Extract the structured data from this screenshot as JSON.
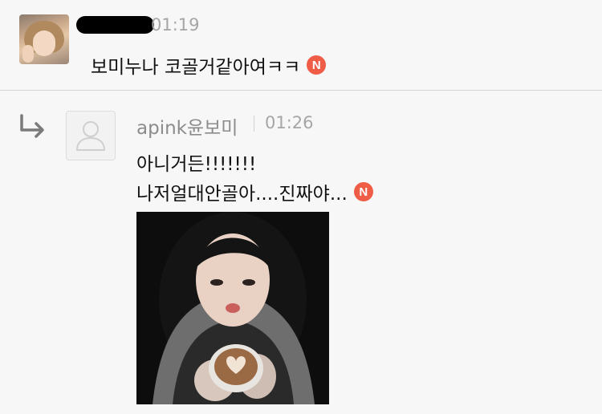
{
  "comments": [
    {
      "time": "01:19",
      "text": "보미누나 코골거같아여ㅋㅋ",
      "new_badge": "N"
    },
    {
      "author": "apink윤보미",
      "time": "01:26",
      "text_line1": "아니거든!!!!!!!",
      "text_line2": "나저얼대안골아....진짜야...",
      "new_badge": "N"
    }
  ],
  "colors": {
    "background": "#f7f7f7",
    "new_badge": "#ef5d47",
    "meta_text": "#a6a6a6"
  },
  "icons": {
    "reply": "reply-arrow-icon",
    "default_avatar": "default-profile-icon"
  }
}
